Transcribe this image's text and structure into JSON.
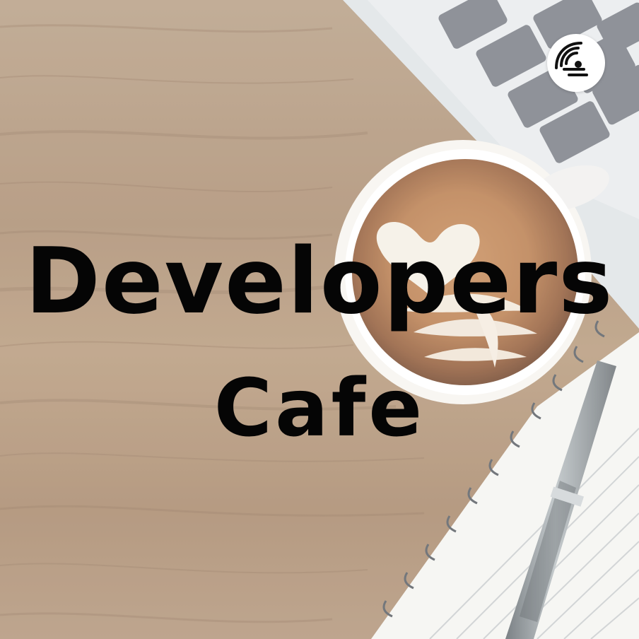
{
  "title": {
    "line1": "Developers",
    "line2": "Cafe"
  },
  "badge": {
    "icon": "anchor-podcast-icon"
  },
  "colors": {
    "wood": "#b5997c",
    "text": "#050505",
    "badge": "#ffffff",
    "laptop": "#d8dde1",
    "keys": "#7c8088",
    "coffee": "#a86d45",
    "notebook": "#f7f7f5",
    "pen": "#8f969a"
  }
}
